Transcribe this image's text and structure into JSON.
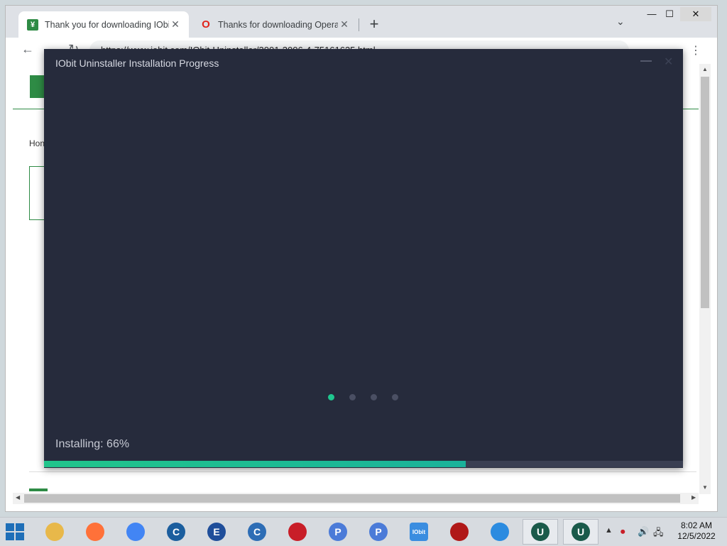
{
  "browser": {
    "tabs": [
      {
        "title": "Thank you for downloading IObit",
        "active": true
      },
      {
        "title": "Thanks for downloading Opera",
        "active": false
      }
    ],
    "new_tab_glyph": "+",
    "url": "https://www.iobit.com/IObit-Uninstaller/2001-3006-4-75161635.html",
    "page": {
      "breadcrumb_home": "Hon"
    }
  },
  "installer": {
    "title": "IObit Uninstaller Installation Progress",
    "status_text": "Installing: 66%",
    "progress_fraction": 0.66,
    "slide_count": 4,
    "active_slide": 0,
    "accent_color": "#1fc78f",
    "background_color": "#262b3c"
  },
  "taskbar": {
    "items": [
      {
        "icon": "file-explorer-icon",
        "color": "#e8b84a",
        "glyph": ""
      },
      {
        "icon": "firefox-icon",
        "color": "#ff7139",
        "glyph": ""
      },
      {
        "icon": "chrome-icon",
        "color": "#4285f4",
        "glyph": ""
      },
      {
        "icon": "ccleaner-icon",
        "color": "#1b5e9e",
        "glyph": "C"
      },
      {
        "icon": "blue-app-icon",
        "color": "#1f4e9a",
        "glyph": "E"
      },
      {
        "icon": "ccleaner-browser-icon",
        "color": "#2d6db5",
        "glyph": "C"
      },
      {
        "icon": "screen-recorder-icon",
        "color": "#c81e28",
        "glyph": ""
      },
      {
        "icon": "p-app-icon",
        "color": "#4b7bd8",
        "glyph": "P"
      },
      {
        "icon": "p-app-2-icon",
        "color": "#4b7bd8",
        "glyph": "P"
      },
      {
        "icon": "iobit-installer-icon",
        "color": "#3a8de0",
        "glyph": "IObit"
      },
      {
        "icon": "red-app-icon",
        "color": "#b01818",
        "glyph": ""
      },
      {
        "icon": "shield-app-icon",
        "color": "#2b8be0",
        "glyph": ""
      },
      {
        "icon": "iobit-uninstaller-icon",
        "color": "#1a5a4a",
        "glyph": "U"
      },
      {
        "icon": "iobit-uninstaller-2-icon",
        "color": "#1a5a4a",
        "glyph": "U"
      }
    ],
    "time": "8:02 AM",
    "date": "12/5/2022"
  }
}
